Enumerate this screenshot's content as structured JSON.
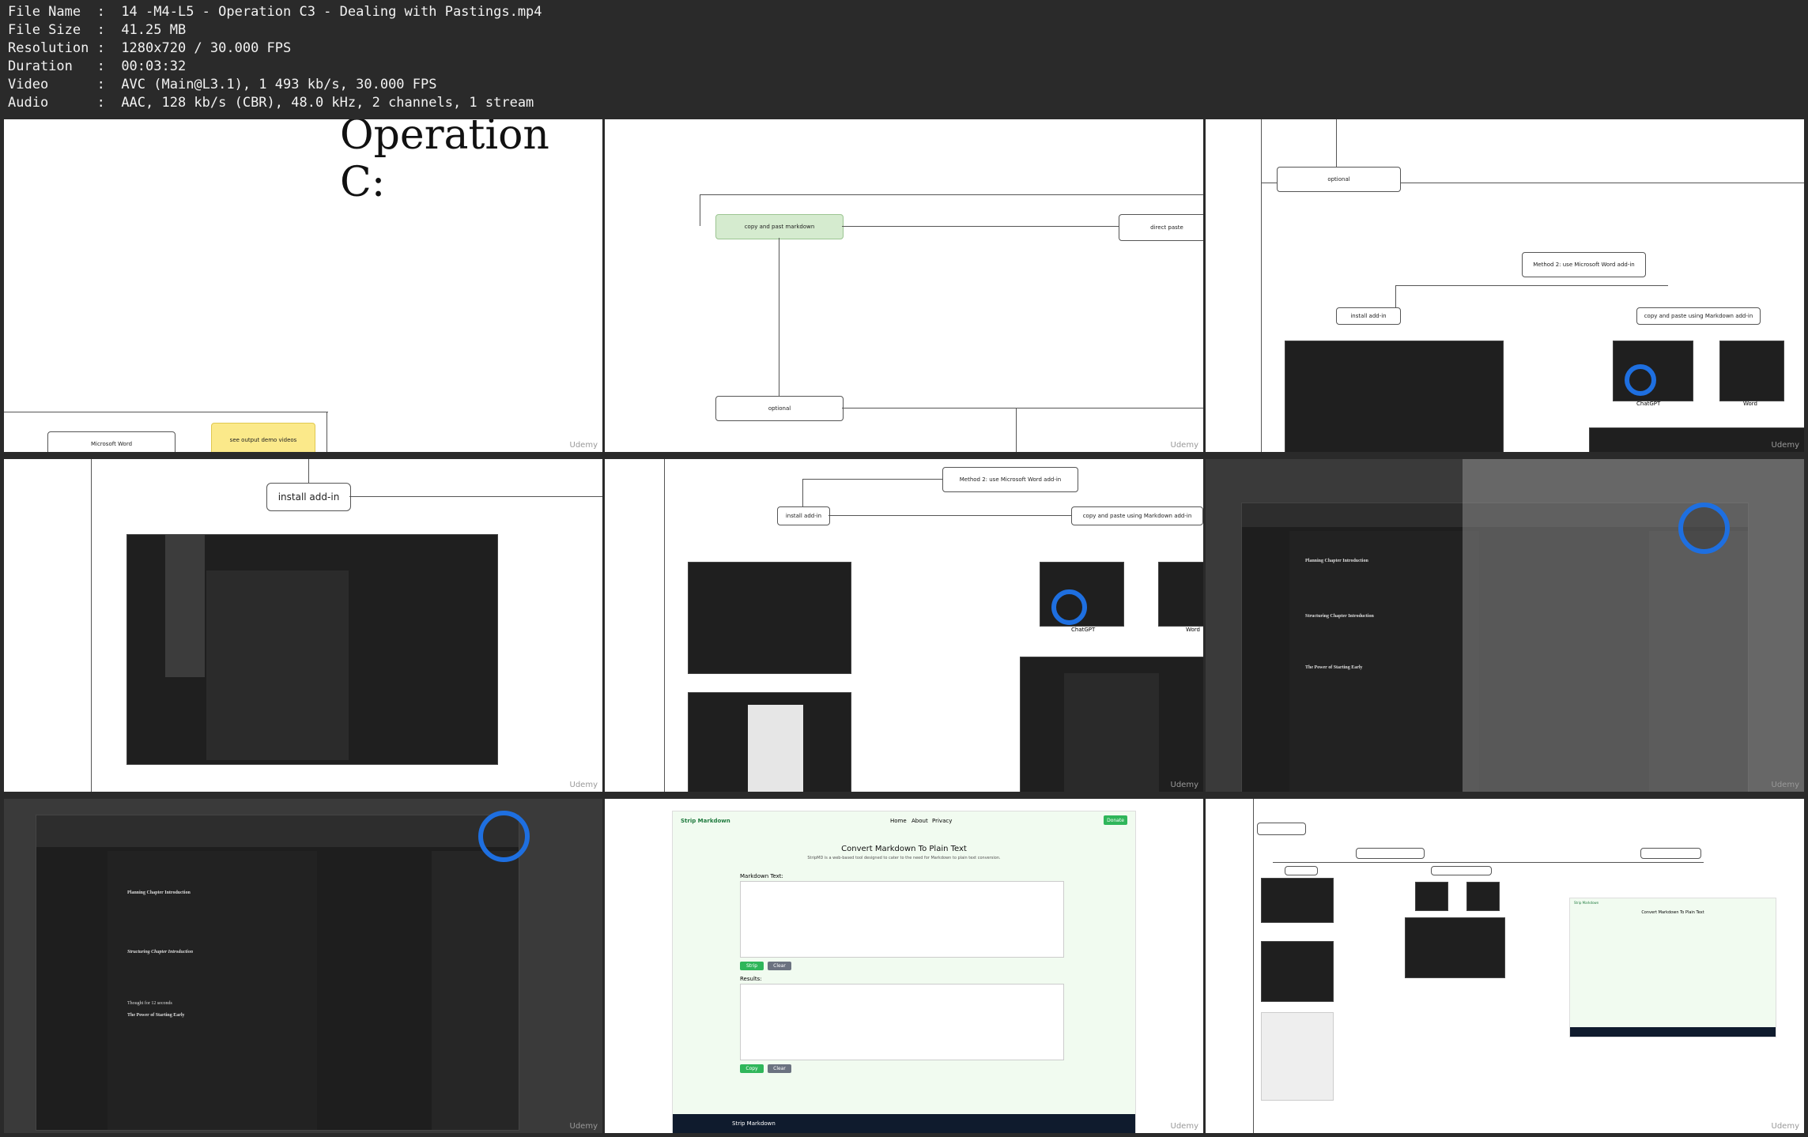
{
  "info": {
    "file_name_label": "File Name",
    "file_name": "14 -M4-L5 - Operation C3 - Dealing with Pastings.mp4",
    "file_size_label": "File Size",
    "file_size": "41.25 MB",
    "resolution_label": "Resolution",
    "resolution": "1280x720 / 30.000 FPS",
    "duration_label": "Duration",
    "duration": "00:03:32",
    "video_label": "Video",
    "video": "AVC (Main@L3.1), 1 493 kb/s, 30.000 FPS",
    "audio_label": "Audio",
    "audio": "AAC, 128 kb/s (CBR), 48.0 kHz, 2 channels, 1 stream"
  },
  "watermark": "Udemy",
  "frame1": {
    "title": "Operation C:",
    "word_box": "Microsoft Word",
    "note": "see output demo videos"
  },
  "frame2": {
    "copy_paste": "copy and past markdown",
    "direct_paste": "direct paste",
    "optional": "optional"
  },
  "frame3": {
    "optional": "optional",
    "method2": "Method 2: use Microsoft Word add-in",
    "install": "install add-in",
    "copy_paste": "copy and paste using Markdown add-in",
    "chatgpt": "ChatGPT",
    "word": "Word"
  },
  "frame4": {
    "install": "install add-in"
  },
  "frame5": {
    "method2": "Method 2: use Microsoft Word add-in",
    "install": "install add-in",
    "copy_paste": "copy and paste using Markdown add-in",
    "chatgpt": "ChatGPT",
    "word": "Word"
  },
  "frame6": {
    "h1": "Planning Chapter Introduction",
    "h2": "Structuring Chapter Introduction",
    "h3": "The Power of Starting Early"
  },
  "frame7": {
    "h1": "Planning Chapter Introduction",
    "h2": "Structuring Chapter Introduction",
    "thought": "Thought for 12 seconds",
    "h3": "The Power of Starting Early"
  },
  "frame8": {
    "brand": "Strip Markdown",
    "nav": [
      "Home",
      "About",
      "Privacy"
    ],
    "donate": "Donate",
    "title": "Convert Markdown To Plain Text",
    "subtitle": "StripMD is a web-based tool designed to cater to the need for Markdown to plain text conversion.",
    "markdown_label": "Markdown Text:",
    "results_label": "Results:",
    "strip_btn": "Strip",
    "clear_btn": "Clear",
    "copy_btn": "Copy",
    "clear_btn2": "Clear",
    "footer_brand": "Strip Markdown"
  },
  "frame9": {
    "brand": "Strip Markdown",
    "title": "Convert Markdown To Plain Text"
  }
}
